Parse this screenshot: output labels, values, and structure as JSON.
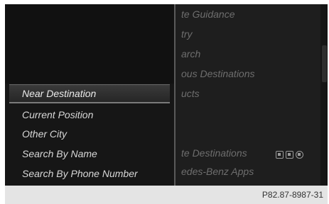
{
  "background_menu": {
    "items": [
      "te Guidance",
      "try",
      "arch",
      "ous Destinations",
      "ucts",
      "te Destinations",
      "edes-Benz Apps"
    ],
    "icon_names": [
      "note-icon",
      "card-icon",
      "settings-icon"
    ]
  },
  "submenu": {
    "selected": "Near Destination",
    "items": [
      "Current Position",
      "Other City",
      "Search By Name",
      "Search By Phone Number"
    ]
  },
  "footer": {
    "code": "P82.87-8987-31"
  }
}
